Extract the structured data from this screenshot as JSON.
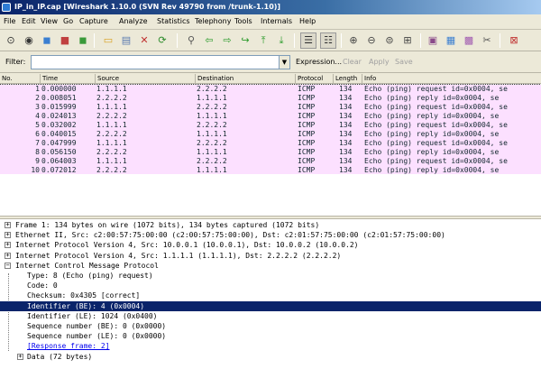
{
  "window": {
    "title": "IP_in_IP.cap  [Wireshark 1.10.0  (SVN Rev 49790 from /trunk-1.10)]"
  },
  "menu": [
    "File",
    "Edit",
    "View",
    "Go",
    "Capture",
    "Analyze",
    "Statistics",
    "Telephony",
    "Tools",
    "Internals",
    "Help"
  ],
  "toolbar": {
    "icons": [
      "interface-list-icon",
      "capture-options-icon",
      "start-capture-icon",
      "stop-capture-icon",
      "restart-capture-icon",
      "open-file-icon",
      "save-file-icon",
      "close-file-icon",
      "reload-icon",
      "find-packet-icon",
      "go-back-icon",
      "go-forward-icon",
      "go-to-packet-icon",
      "go-first-icon",
      "go-last-icon",
      "colorize-icon",
      "auto-scroll-icon",
      "zoom-in-icon",
      "zoom-out-icon",
      "zoom-normal-icon",
      "resize-columns-icon",
      "capture-filters-icon",
      "display-filters-icon",
      "coloring-rules-icon",
      "preferences-icon",
      "help-icon"
    ]
  },
  "filter": {
    "label": "Filter:",
    "value": "",
    "expression": "Expression...",
    "clear": "Clear",
    "apply": "Apply",
    "save": "Save"
  },
  "packet_list": {
    "columns": [
      "No.",
      "Time",
      "Source",
      "Destination",
      "Protocol",
      "Length",
      "Info"
    ],
    "rows": [
      {
        "no": "1",
        "time": "0.000000",
        "source": "1.1.1.1",
        "destination": "2.2.2.2",
        "protocol": "ICMP",
        "length": "134",
        "info": "Echo (ping) request   id=0x0004, se",
        "bg": "#fce0ff"
      },
      {
        "no": "2",
        "time": "0.008051",
        "source": "2.2.2.2",
        "destination": "1.1.1.1",
        "protocol": "ICMP",
        "length": "134",
        "info": "Echo (ping) reply     id=0x0004, se",
        "bg": "#fce0ff"
      },
      {
        "no": "3",
        "time": "0.015999",
        "source": "1.1.1.1",
        "destination": "2.2.2.2",
        "protocol": "ICMP",
        "length": "134",
        "info": "Echo (ping) request   id=0x0004, se",
        "bg": "#fce0ff"
      },
      {
        "no": "4",
        "time": "0.024013",
        "source": "2.2.2.2",
        "destination": "1.1.1.1",
        "protocol": "ICMP",
        "length": "134",
        "info": "Echo (ping) reply     id=0x0004, se",
        "bg": "#fce0ff"
      },
      {
        "no": "5",
        "time": "0.032002",
        "source": "1.1.1.1",
        "destination": "2.2.2.2",
        "protocol": "ICMP",
        "length": "134",
        "info": "Echo (ping) request   id=0x0004, se",
        "bg": "#fce0ff"
      },
      {
        "no": "6",
        "time": "0.040015",
        "source": "2.2.2.2",
        "destination": "1.1.1.1",
        "protocol": "ICMP",
        "length": "134",
        "info": "Echo (ping) reply     id=0x0004, se",
        "bg": "#fce0ff"
      },
      {
        "no": "7",
        "time": "0.047999",
        "source": "1.1.1.1",
        "destination": "2.2.2.2",
        "protocol": "ICMP",
        "length": "134",
        "info": "Echo (ping) request   id=0x0004, se",
        "bg": "#fce0ff"
      },
      {
        "no": "8",
        "time": "0.056150",
        "source": "2.2.2.2",
        "destination": "1.1.1.1",
        "protocol": "ICMP",
        "length": "134",
        "info": "Echo (ping) reply     id=0x0004, se",
        "bg": "#fce0ff"
      },
      {
        "no": "9",
        "time": "0.064003",
        "source": "1.1.1.1",
        "destination": "2.2.2.2",
        "protocol": "ICMP",
        "length": "134",
        "info": "Echo (ping) request   id=0x0004, se",
        "bg": "#fce0ff"
      },
      {
        "no": "10",
        "time": "0.072012",
        "source": "2.2.2.2",
        "destination": "1.1.1.1",
        "protocol": "ICMP",
        "length": "134",
        "info": "Echo (ping) reply     id=0x0004, se",
        "bg": "#fce0ff"
      }
    ]
  },
  "details": {
    "rows": [
      {
        "text": "Frame 1: 134 bytes on wire (1072 bits), 134 bytes captured (1072 bits)",
        "expander": "+",
        "level": 0
      },
      {
        "text": "Ethernet II, Src: c2:00:57:75:00:00 (c2:00:57:75:00:00), Dst: c2:01:57:75:00:00 (c2:01:57:75:00:00)",
        "expander": "+",
        "level": 0
      },
      {
        "text": "Internet Protocol Version 4, Src: 10.0.0.1 (10.0.0.1), Dst: 10.0.0.2 (10.0.0.2)",
        "expander": "+",
        "level": 0
      },
      {
        "text": "Internet Protocol Version 4, Src: 1.1.1.1 (1.1.1.1), Dst: 2.2.2.2 (2.2.2.2)",
        "expander": "+",
        "level": 0
      },
      {
        "text": "Internet Control Message Protocol",
        "expander": "−",
        "level": 0
      },
      {
        "text": "Type: 8 (Echo (ping) request)",
        "expander": "",
        "level": 1
      },
      {
        "text": "Code: 0",
        "expander": "",
        "level": 1
      },
      {
        "text": "Checksum: 0x4305 [correct]",
        "expander": "",
        "level": 1
      },
      {
        "text": "Identifier (BE): 4 (0x0004)",
        "expander": "",
        "level": 1,
        "selected": true
      },
      {
        "text": "Identifier (LE): 1024 (0x0400)",
        "expander": "",
        "level": 1
      },
      {
        "text": "Sequence number (BE): 0 (0x0000)",
        "expander": "",
        "level": 1
      },
      {
        "text": "Sequence number (LE): 0 (0x0000)",
        "expander": "",
        "level": 1
      },
      {
        "text": "[Response frame: 2]",
        "expander": "",
        "level": 1,
        "link": true
      },
      {
        "text": "Data (72 bytes)",
        "expander": "+",
        "level": 1
      }
    ]
  },
  "colors": {
    "icmp_row_bg": "#fce0ff",
    "selected_detail_bg": "#0a246a",
    "link": "#0000ee"
  }
}
